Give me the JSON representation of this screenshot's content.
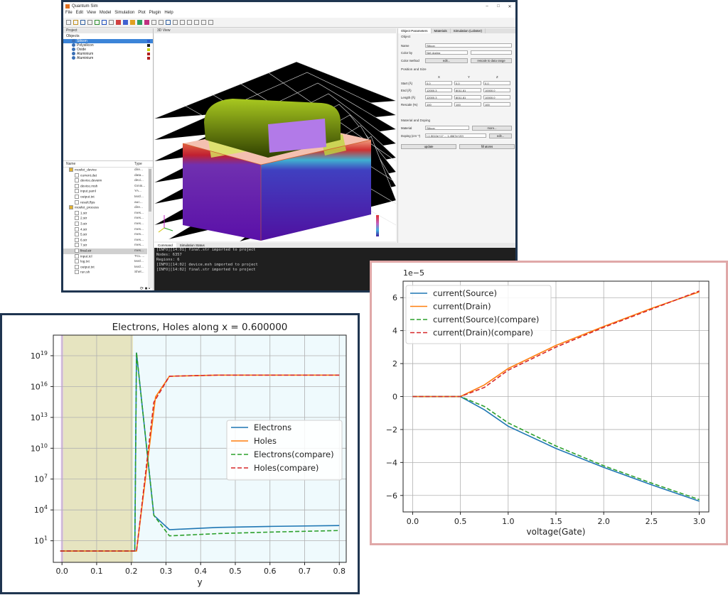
{
  "window": {
    "title": "Quantum Sim",
    "controls": [
      "–",
      "□",
      "✕"
    ],
    "menu": [
      "File",
      "Edit",
      "View",
      "Model",
      "Simulation",
      "Plot",
      "Plugin",
      "Help"
    ]
  },
  "project_panel": {
    "tab": "Project",
    "objects_label": "Objects",
    "objects": [
      {
        "name": "Silicon",
        "selected": true,
        "color": "#3060d0"
      },
      {
        "name": "Polysilicon",
        "selected": false,
        "color": "#202020"
      },
      {
        "name": "Oxide",
        "selected": false,
        "color": "#c8d000"
      },
      {
        "name": "Aluminium",
        "selected": false,
        "color": "#b02020"
      },
      {
        "name": "Aluminium",
        "selected": false,
        "color": "#b02020"
      }
    ],
    "tree_header": {
      "name": "Name",
      "type": "Type"
    },
    "tree": [
      {
        "name": "mosfet_device",
        "type": "dire...",
        "folder": true,
        "indent": 1
      },
      {
        "name": "current.dat",
        "type": "data...",
        "indent": 2
      },
      {
        "name": "device.devsim",
        "type": "devi...",
        "indent": 2
      },
      {
        "name": "device.msh",
        "type": "Gmis...",
        "indent": 2
      },
      {
        "name": "input.yaml",
        "type": "YA...",
        "indent": 2
      },
      {
        "name": "output.txt",
        "type": "text/...",
        "indent": 2
      },
      {
        "name": "result.flps",
        "type": "auc...",
        "indent": 2
      },
      {
        "name": "mosfet_process",
        "type": "dire...",
        "folder": true,
        "indent": 1
      },
      {
        "name": "1.str",
        "type": "mes...",
        "indent": 2
      },
      {
        "name": "2.str",
        "type": "mes...",
        "indent": 2
      },
      {
        "name": "3.str",
        "type": "mes...",
        "indent": 2
      },
      {
        "name": "4.str",
        "type": "mes...",
        "indent": 2
      },
      {
        "name": "5.str",
        "type": "mes...",
        "indent": 2
      },
      {
        "name": "6.str",
        "type": "mes...",
        "indent": 2
      },
      {
        "name": "7.str",
        "type": "mes...",
        "indent": 2
      },
      {
        "name": "final.str",
        "type": "mes...",
        "indent": 2,
        "selected": true
      },
      {
        "name": "input.tcl",
        "type": "TCL ...",
        "indent": 2
      },
      {
        "name": "log.txt",
        "type": "text/...",
        "indent": 2
      },
      {
        "name": "output.txt",
        "type": "text/...",
        "indent": 2
      },
      {
        "name": "run.sh",
        "type": "Shel...",
        "indent": 2
      }
    ]
  },
  "view3d": {
    "tab": "3D View"
  },
  "params": {
    "tabs": [
      "Object Parameters",
      "Materials",
      "Simulation (Lobster)"
    ],
    "object_section": "Object",
    "name_label": "Name",
    "name_value": "Silicon",
    "color_by_label": "Color by",
    "color_by_value": "Net doping",
    "color_method_label": "Color method",
    "edit_btn": "edit...",
    "rescale_btn": "rescale to data range",
    "position_section": "Position and Size",
    "xyz_headers": [
      "X",
      "Y",
      "Z"
    ],
    "rows": [
      {
        "label": "Start (Å)",
        "values": [
          "0.0",
          "0.0",
          "0.0"
        ]
      },
      {
        "label": "End (Å)",
        "values": [
          "12000.3",
          "8011.81",
          "10000.0"
        ]
      },
      {
        "label": "Length (Å)",
        "values": [
          "12000.3",
          "8011.81",
          "10000.0"
        ]
      },
      {
        "label": "Rescale (%)",
        "values": [
          "100",
          "100",
          "100"
        ]
      }
    ],
    "material_section": "Material and Doping",
    "material_label": "Material",
    "material_value": "Silicon",
    "more_btn": "more...",
    "doping_label": "Doping (cm⁻³)",
    "doping_value": "[-1.5010e+17 ... 1.4567e+20]",
    "update_btn": "update",
    "fill_btn": "fill atoms"
  },
  "console": {
    "tabs": [
      "Command",
      "Simulation Status"
    ],
    "lines": [
      "[INFO][14:01] final.str imported to project",
      "Nodes: 6357",
      "Regions: 6",
      "[INFO][14:02] device.msh imported to project",
      "[INFO][14:02] final.str imported to project"
    ]
  },
  "chart_data": [
    {
      "type": "line",
      "title": "Electrons, Holes along x = 0.600000",
      "xlabel": "y",
      "ylabel": "",
      "yscale": "log",
      "xlim": [
        -0.025,
        0.82
      ],
      "ylim": [
        0.08,
        1e+21
      ],
      "xticks": [
        "0.0",
        "0.1",
        "0.2",
        "0.3",
        "0.4",
        "0.5",
        "0.6",
        "0.7",
        "0.8"
      ],
      "yticks": [
        "10^1",
        "10^4",
        "10^7",
        "10^10",
        "10^13",
        "10^16",
        "10^19"
      ],
      "grid": true,
      "legend_position": "center-right",
      "shaded_regions": [
        {
          "x": [
            0.0,
            0.205
          ],
          "color": "#e6e4c0"
        },
        {
          "x": [
            0.205,
            0.82
          ],
          "color": "#effafd"
        }
      ],
      "series": [
        {
          "name": "Electrons",
          "color": "#1f77b4",
          "dash": false,
          "x": [
            -0.005,
            0.21,
            0.215,
            0.265,
            0.31,
            0.45,
            0.6,
            0.8
          ],
          "y": [
            1,
            1,
            2e+19,
            3000,
            120,
            200,
            250,
            300
          ]
        },
        {
          "name": "Holes",
          "color": "#ff7f0e",
          "dash": false,
          "x": [
            -0.005,
            0.21,
            0.215,
            0.27,
            0.31,
            0.45,
            0.6,
            0.8
          ],
          "y": [
            1,
            1,
            1,
            1000000000000000.0,
            1e+17,
            1.3e+17,
            1.3e+17,
            1.3e+17
          ]
        },
        {
          "name": "Electrons(compare)",
          "color": "#2ca02c",
          "dash": true,
          "x": [
            -0.005,
            0.21,
            0.215,
            0.265,
            0.31,
            0.45,
            0.6,
            0.8
          ],
          "y": [
            1,
            1,
            2e+19,
            3000,
            30,
            50,
            70,
            100
          ]
        },
        {
          "name": "Holes(compare)",
          "color": "#d62728",
          "dash": true,
          "x": [
            -0.005,
            0.21,
            0.215,
            0.265,
            0.31,
            0.45,
            0.6,
            0.8
          ],
          "y": [
            1,
            1,
            1,
            300000000000000.0,
            1e+17,
            1.3e+17,
            1.3e+17,
            1.3e+17
          ]
        }
      ]
    },
    {
      "type": "line",
      "title": "",
      "xlabel": "voltage(Gate)",
      "ylabel": "",
      "offset_label": "1e−5",
      "xlim": [
        -0.1,
        3.1
      ],
      "ylim": [
        -7,
        7
      ],
      "xticks": [
        "0.0",
        "0.5",
        "1.0",
        "1.5",
        "2.0",
        "2.5",
        "3.0"
      ],
      "yticks": [
        "−6",
        "−4",
        "−2",
        "0",
        "2",
        "4",
        "6"
      ],
      "grid": true,
      "legend_position": "top-left",
      "series": [
        {
          "name": "current(Source)",
          "color": "#1f77b4",
          "dash": false,
          "x": [
            0,
            0.5,
            0.75,
            1.0,
            1.5,
            2.0,
            2.5,
            3.0
          ],
          "y": [
            0,
            0,
            -0.8,
            -1.8,
            -3.15,
            -4.3,
            -5.35,
            -6.35
          ]
        },
        {
          "name": "current(Drain)",
          "color": "#ff7f0e",
          "dash": false,
          "x": [
            0,
            0.5,
            0.75,
            1.0,
            1.5,
            2.0,
            2.5,
            3.0
          ],
          "y": [
            0,
            0,
            0.7,
            1.7,
            3.1,
            4.25,
            5.35,
            6.35
          ]
        },
        {
          "name": "current(Source)(compare)",
          "color": "#2ca02c",
          "dash": true,
          "x": [
            0,
            0.5,
            0.75,
            1.0,
            1.5,
            2.0,
            2.5,
            3.0
          ],
          "y": [
            0,
            0,
            -0.6,
            -1.6,
            -3.0,
            -4.2,
            -5.25,
            -6.25
          ]
        },
        {
          "name": "current(Drain)(compare)",
          "color": "#d62728",
          "dash": true,
          "x": [
            0,
            0.5,
            0.75,
            1.0,
            1.5,
            2.0,
            2.5,
            3.0
          ],
          "y": [
            0,
            0,
            0.55,
            1.6,
            3.0,
            4.2,
            5.3,
            6.4
          ]
        }
      ]
    }
  ]
}
